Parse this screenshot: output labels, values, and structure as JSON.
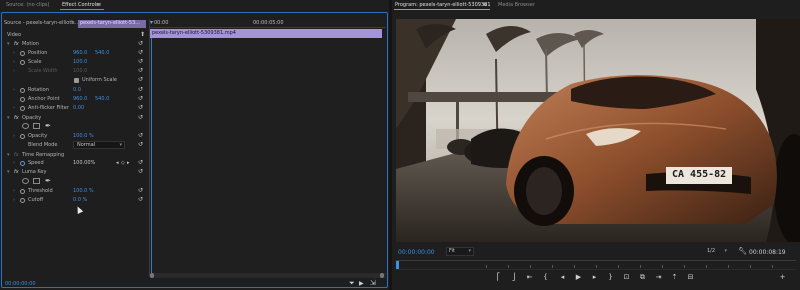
{
  "left_panel": {
    "tabs": [
      {
        "label": "Source: (no clips)"
      },
      {
        "label": "Effect Controls",
        "menu_glyph": "≡"
      },
      {
        "label": "Audio Track Mixer: Sequence 01",
        "hidden": true
      }
    ],
    "source_selector": "Source - pexels-taryn-elliott...",
    "clip_selector": "pexels-taryn-elliott-53...",
    "section_label": "Video",
    "timeline": {
      "start_tc": "00:00",
      "end_tc": "00:00:05:00",
      "clip_name": "pexels-taryn-elliott-5309381.mp4"
    },
    "effects": {
      "motion": {
        "name": "Motion",
        "position": {
          "label": "Position",
          "x": "960.0",
          "y": "540.0"
        },
        "scale": {
          "label": "Scale",
          "value": "100.0"
        },
        "scale_width": {
          "label": "Scale Width",
          "value": "100.0"
        },
        "uniform_scale": {
          "label": "Uniform Scale",
          "checked": true
        },
        "rotation": {
          "label": "Rotation",
          "value": "0.0"
        },
        "anchor_point": {
          "label": "Anchor Point",
          "x": "960.0",
          "y": "540.0"
        },
        "anti_flicker": {
          "label": "Anti-flicker Filter",
          "value": "0.00"
        }
      },
      "opacity": {
        "name": "Opacity",
        "opacity": {
          "label": "Opacity",
          "value": "100.0 %"
        },
        "blend_mode": {
          "label": "Blend Mode",
          "value": "Normal"
        }
      },
      "time_remapping": {
        "name": "Time Remapping",
        "speed": {
          "label": "Speed",
          "value": "100.00%"
        }
      },
      "luma_key": {
        "name": "Luma Key",
        "threshold": {
          "label": "Threshold",
          "value": "100.0 %"
        },
        "cutoff": {
          "label": "Cutoff",
          "value": "0.0 %"
        }
      }
    },
    "footer_tc": "00:00:00:00"
  },
  "right_panel": {
    "tabs": [
      {
        "label": "Program: pexels-taryn-elliott-5309381",
        "menu_glyph": "≡"
      },
      {
        "label": "Media Browser"
      }
    ],
    "timecode_left": "00:00:00:00",
    "fit_label": "Fit",
    "resolution_label": "1/2",
    "timecode_right": "00:00:08:19",
    "plate_text": "CA 455-82",
    "controls": [
      {
        "icon": "mark-in-icon",
        "glyph": "⎡"
      },
      {
        "icon": "mark-out-icon",
        "glyph": "⎦"
      },
      {
        "icon": "insert-icon",
        "glyph": "⇤"
      },
      {
        "icon": "go-to-in-icon",
        "glyph": "{"
      },
      {
        "icon": "step-back-icon",
        "glyph": "◂"
      },
      {
        "icon": "play-icon",
        "glyph": "▶"
      },
      {
        "icon": "step-forward-icon",
        "glyph": "▸"
      },
      {
        "icon": "go-to-out-icon",
        "glyph": "}"
      },
      {
        "icon": "export-frame-icon",
        "glyph": "⊡"
      },
      {
        "icon": "comparison-view-icon",
        "glyph": "⧉"
      },
      {
        "icon": "overwrite-icon",
        "glyph": "⇥"
      },
      {
        "icon": "lift-icon",
        "glyph": "⇡"
      },
      {
        "icon": "extract-icon",
        "glyph": "⊟"
      },
      {
        "icon": "add-icon",
        "glyph": "+"
      }
    ]
  },
  "colors": {
    "accent_blue": "#3d8fe0",
    "clip_purple": "#a593d8",
    "panel_bg": "#232323",
    "timeline_bg": "#1f1f1f"
  }
}
